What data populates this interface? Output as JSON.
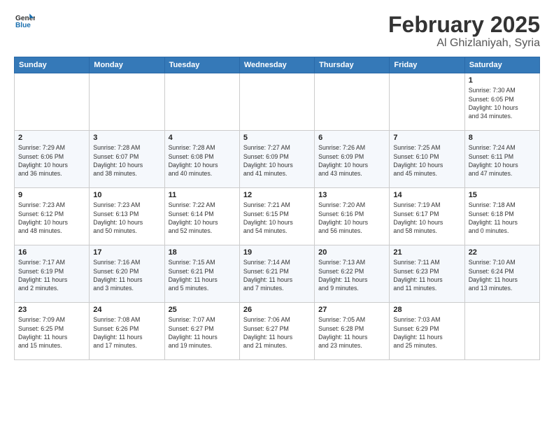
{
  "logo": {
    "line1": "General",
    "line2": "Blue"
  },
  "header": {
    "month": "February 2025",
    "location": "Al Ghizlaniyah, Syria"
  },
  "weekdays": [
    "Sunday",
    "Monday",
    "Tuesday",
    "Wednesday",
    "Thursday",
    "Friday",
    "Saturday"
  ],
  "weeks": [
    [
      {
        "day": "",
        "info": ""
      },
      {
        "day": "",
        "info": ""
      },
      {
        "day": "",
        "info": ""
      },
      {
        "day": "",
        "info": ""
      },
      {
        "day": "",
        "info": ""
      },
      {
        "day": "",
        "info": ""
      },
      {
        "day": "1",
        "info": "Sunrise: 7:30 AM\nSunset: 6:05 PM\nDaylight: 10 hours\nand 34 minutes."
      }
    ],
    [
      {
        "day": "2",
        "info": "Sunrise: 7:29 AM\nSunset: 6:06 PM\nDaylight: 10 hours\nand 36 minutes."
      },
      {
        "day": "3",
        "info": "Sunrise: 7:28 AM\nSunset: 6:07 PM\nDaylight: 10 hours\nand 38 minutes."
      },
      {
        "day": "4",
        "info": "Sunrise: 7:28 AM\nSunset: 6:08 PM\nDaylight: 10 hours\nand 40 minutes."
      },
      {
        "day": "5",
        "info": "Sunrise: 7:27 AM\nSunset: 6:09 PM\nDaylight: 10 hours\nand 41 minutes."
      },
      {
        "day": "6",
        "info": "Sunrise: 7:26 AM\nSunset: 6:09 PM\nDaylight: 10 hours\nand 43 minutes."
      },
      {
        "day": "7",
        "info": "Sunrise: 7:25 AM\nSunset: 6:10 PM\nDaylight: 10 hours\nand 45 minutes."
      },
      {
        "day": "8",
        "info": "Sunrise: 7:24 AM\nSunset: 6:11 PM\nDaylight: 10 hours\nand 47 minutes."
      }
    ],
    [
      {
        "day": "9",
        "info": "Sunrise: 7:23 AM\nSunset: 6:12 PM\nDaylight: 10 hours\nand 48 minutes."
      },
      {
        "day": "10",
        "info": "Sunrise: 7:23 AM\nSunset: 6:13 PM\nDaylight: 10 hours\nand 50 minutes."
      },
      {
        "day": "11",
        "info": "Sunrise: 7:22 AM\nSunset: 6:14 PM\nDaylight: 10 hours\nand 52 minutes."
      },
      {
        "day": "12",
        "info": "Sunrise: 7:21 AM\nSunset: 6:15 PM\nDaylight: 10 hours\nand 54 minutes."
      },
      {
        "day": "13",
        "info": "Sunrise: 7:20 AM\nSunset: 6:16 PM\nDaylight: 10 hours\nand 56 minutes."
      },
      {
        "day": "14",
        "info": "Sunrise: 7:19 AM\nSunset: 6:17 PM\nDaylight: 10 hours\nand 58 minutes."
      },
      {
        "day": "15",
        "info": "Sunrise: 7:18 AM\nSunset: 6:18 PM\nDaylight: 11 hours\nand 0 minutes."
      }
    ],
    [
      {
        "day": "16",
        "info": "Sunrise: 7:17 AM\nSunset: 6:19 PM\nDaylight: 11 hours\nand 2 minutes."
      },
      {
        "day": "17",
        "info": "Sunrise: 7:16 AM\nSunset: 6:20 PM\nDaylight: 11 hours\nand 3 minutes."
      },
      {
        "day": "18",
        "info": "Sunrise: 7:15 AM\nSunset: 6:21 PM\nDaylight: 11 hours\nand 5 minutes."
      },
      {
        "day": "19",
        "info": "Sunrise: 7:14 AM\nSunset: 6:21 PM\nDaylight: 11 hours\nand 7 minutes."
      },
      {
        "day": "20",
        "info": "Sunrise: 7:13 AM\nSunset: 6:22 PM\nDaylight: 11 hours\nand 9 minutes."
      },
      {
        "day": "21",
        "info": "Sunrise: 7:11 AM\nSunset: 6:23 PM\nDaylight: 11 hours\nand 11 minutes."
      },
      {
        "day": "22",
        "info": "Sunrise: 7:10 AM\nSunset: 6:24 PM\nDaylight: 11 hours\nand 13 minutes."
      }
    ],
    [
      {
        "day": "23",
        "info": "Sunrise: 7:09 AM\nSunset: 6:25 PM\nDaylight: 11 hours\nand 15 minutes."
      },
      {
        "day": "24",
        "info": "Sunrise: 7:08 AM\nSunset: 6:26 PM\nDaylight: 11 hours\nand 17 minutes."
      },
      {
        "day": "25",
        "info": "Sunrise: 7:07 AM\nSunset: 6:27 PM\nDaylight: 11 hours\nand 19 minutes."
      },
      {
        "day": "26",
        "info": "Sunrise: 7:06 AM\nSunset: 6:27 PM\nDaylight: 11 hours\nand 21 minutes."
      },
      {
        "day": "27",
        "info": "Sunrise: 7:05 AM\nSunset: 6:28 PM\nDaylight: 11 hours\nand 23 minutes."
      },
      {
        "day": "28",
        "info": "Sunrise: 7:03 AM\nSunset: 6:29 PM\nDaylight: 11 hours\nand 25 minutes."
      },
      {
        "day": "",
        "info": ""
      }
    ]
  ]
}
